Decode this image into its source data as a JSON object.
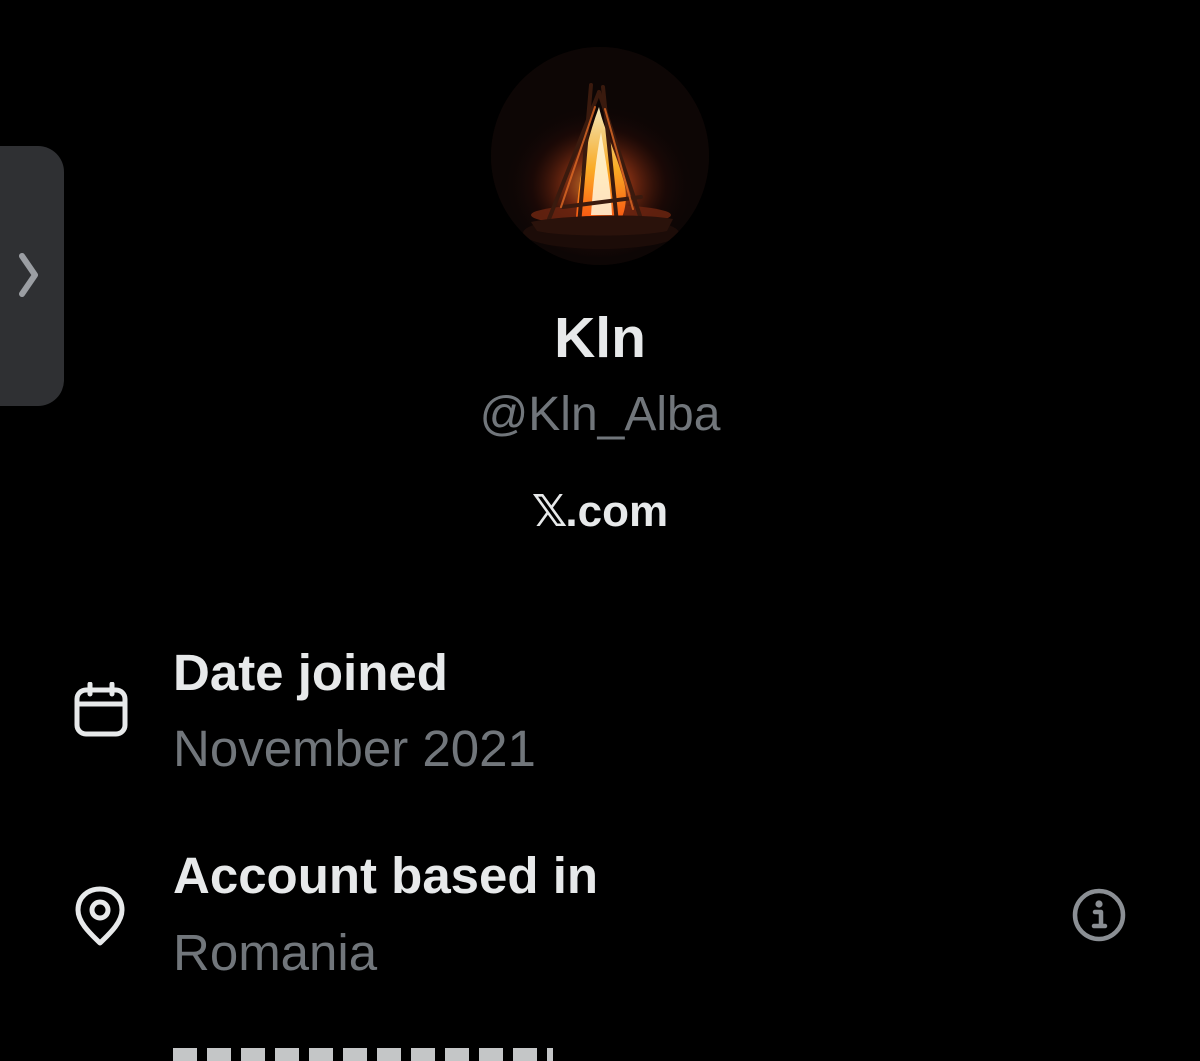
{
  "profile": {
    "display_name": "Kln",
    "handle": "@Kln_Alba",
    "platform": {
      "x_mark": "𝕏",
      "suffix": ".com"
    }
  },
  "about": {
    "date_joined": {
      "label": "Date joined",
      "value": "November 2021",
      "icon": "calendar-icon"
    },
    "account_based_in": {
      "label": "Account based in",
      "value": "Romania",
      "icon": "location-pin-icon",
      "info_icon": "info-circle-icon"
    }
  },
  "side_tab": {
    "icon": "chevron-right-icon"
  },
  "colors": {
    "background": "#000000",
    "primary_text": "#e7e9ea",
    "secondary_text": "#71767b",
    "side_tab": "#2f3033"
  }
}
